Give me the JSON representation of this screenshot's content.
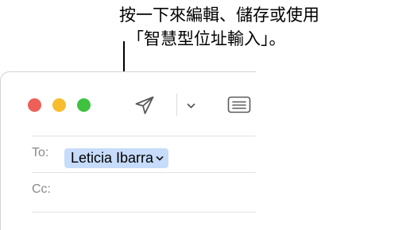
{
  "callout": {
    "line1": "按一下來編輯、儲存或使用",
    "line2": "「智慧型位址輸入」。"
  },
  "window": {
    "traffic_lights": {
      "close": "#ee5f58",
      "minimize": "#f6bd2e",
      "zoom": "#3fc23f"
    },
    "toolbar": {
      "send_icon": "paper-plane-icon",
      "more_icon": "chevron-down-icon",
      "format_icon": "format-text-icon"
    },
    "header": {
      "to_label": "To:",
      "cc_label": "Cc:",
      "recipient": {
        "name": "Leticia Ibarra",
        "token_color": "#c7dcfa",
        "menu_icon": "chevron-down-icon"
      }
    }
  }
}
